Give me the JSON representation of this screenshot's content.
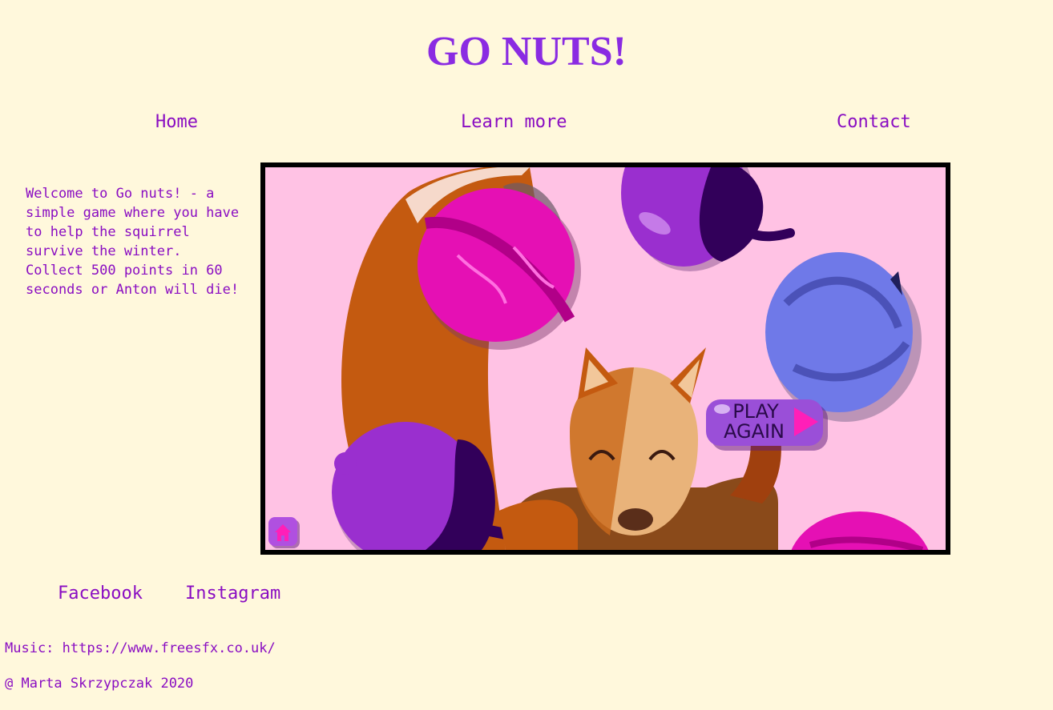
{
  "header": {
    "title": "GO NUTS!"
  },
  "nav": {
    "home": "Home",
    "learn_more": "Learn more",
    "contact": "Contact"
  },
  "intro": {
    "text": "Welcome to Go nuts! - a simple game where you have to help the squirrel survive the winter. Collect 500 points in 60 seconds or Anton will die!"
  },
  "game": {
    "play_again_line1": "PLAY",
    "play_again_line2": "AGAIN",
    "home_icon": "home-icon",
    "colors": {
      "background": "#ffc2e4",
      "walnut": "#e510b4",
      "acorn": "#9a2fcf",
      "acorn_cap": "#32005a",
      "blue_nut": "#6f79e8",
      "squirrel": "#c4570d"
    }
  },
  "social": {
    "facebook": "Facebook",
    "instagram": "Instagram"
  },
  "footer": {
    "music": "Music: https://www.freesfx.co.uk/",
    "copyright": "@ Marta Skrzypczak 2020"
  },
  "colors": {
    "page_bg": "#fff8dc",
    "accent": "#8a0dc2",
    "title": "#8a2be2"
  }
}
